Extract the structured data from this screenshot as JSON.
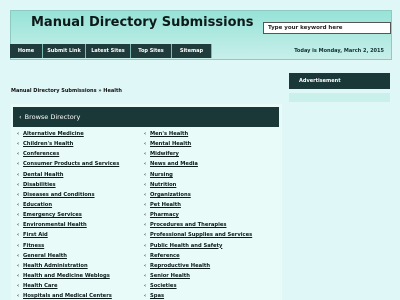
{
  "header": {
    "site_title": "Manual Directory Submissions",
    "search_placeholder": "Type your keyword here"
  },
  "nav": {
    "tabs": [
      {
        "label": "Home"
      },
      {
        "label": "Submit Link"
      },
      {
        "label": "Latest Sites"
      },
      {
        "label": "Top Sites"
      },
      {
        "label": "Sitemap"
      }
    ],
    "date_text": "Today is Monday, March 2, 2015"
  },
  "breadcrumb": "Manual Directory Submissions » Health",
  "browse": {
    "title": "Browse Directory",
    "left_categories": [
      "Alternative Medicine",
      "Children's Health",
      "Conferences",
      "Consumer Products and Services",
      "Dental Health",
      "Disabilities",
      "Diseases and Conditions",
      "Education",
      "Emergency Services",
      "Environmental Health",
      "First Aid",
      "Fitness",
      "General Health",
      "Health Administration",
      "Health and Medicine Weblogs",
      "Health Care",
      "Hospitals and Medical Centers"
    ],
    "right_categories": [
      "Men's Health",
      "Mental Health",
      "Midwifery",
      "News and Media",
      "Nursing",
      "Nutrition",
      "Organizations",
      "Pet Health",
      "Pharmacy",
      "Procedures and Therapies",
      "Professional Supplies and Services",
      "Public Health and Safety",
      "Reference",
      "Reproductive Health",
      "Senior Health",
      "Societies",
      "Spas"
    ]
  },
  "sidebar": {
    "ad_title": "Advertisement"
  }
}
